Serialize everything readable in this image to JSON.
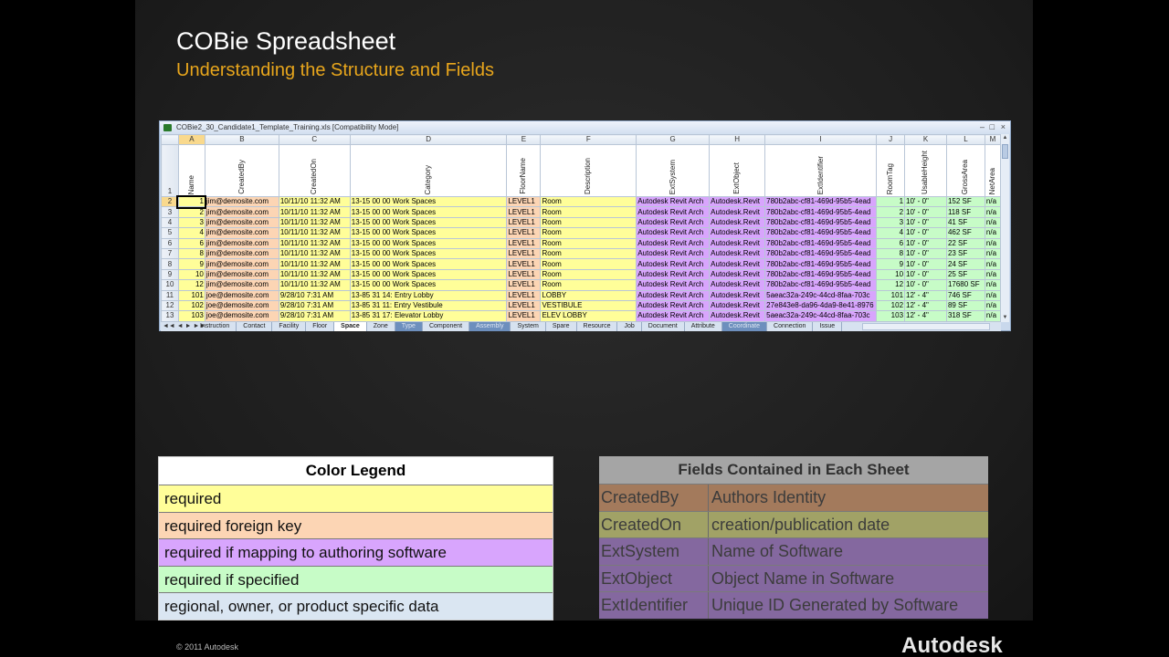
{
  "slide": {
    "title": "COBie Spreadsheet",
    "subtitle": "Understanding the Structure and Fields",
    "copyright": "© 2011 Autodesk",
    "logo": "Autodesk",
    "accent_color": "#e8a61c"
  },
  "workbook": {
    "title": "COBie2_30_Candidate1_Template_Training.xls  [Compatibility Mode]",
    "columns": [
      {
        "letter": "A",
        "field": "Name",
        "fill": "y",
        "selected": true
      },
      {
        "letter": "B",
        "field": "CreatedBy",
        "fill": "o"
      },
      {
        "letter": "C",
        "field": "CreatedOn",
        "fill": "y"
      },
      {
        "letter": "D",
        "field": "Category",
        "fill": "y"
      },
      {
        "letter": "E",
        "field": "FloorName",
        "fill": "o"
      },
      {
        "letter": "F",
        "field": "Description",
        "fill": "y"
      },
      {
        "letter": "G",
        "field": "ExtSystem",
        "fill": "p"
      },
      {
        "letter": "H",
        "field": "ExtObject",
        "fill": "p"
      },
      {
        "letter": "I",
        "field": "ExtIdentifier",
        "fill": "p"
      },
      {
        "letter": "J",
        "field": "RoomTag",
        "fill": "g"
      },
      {
        "letter": "K",
        "field": "UsableHeight",
        "fill": "g"
      },
      {
        "letter": "L",
        "field": "GrossArea",
        "fill": "g"
      },
      {
        "letter": "M",
        "field": "NetArea",
        "fill": "g"
      }
    ],
    "rows": [
      {
        "n": "2",
        "cells": [
          "1",
          "jim@demosite.com",
          "10/11/10 11:32 AM",
          "13-15 00 00 Work Spaces",
          "LEVEL1",
          "Room",
          "Autodesk Revit Arch",
          "Autodesk.Revit",
          "780b2abc-cf81-469d-95b5-4ead",
          "1",
          "10' - 0\"",
          "152 SF",
          "n/a"
        ]
      },
      {
        "n": "3",
        "cells": [
          "2",
          "jim@demosite.com",
          "10/11/10 11:32 AM",
          "13-15 00 00 Work Spaces",
          "LEVEL1",
          "Room",
          "Autodesk Revit Arch",
          "Autodesk.Revit",
          "780b2abc-cf81-469d-95b5-4ead",
          "2",
          "10' - 0\"",
          "118 SF",
          "n/a"
        ]
      },
      {
        "n": "4",
        "cells": [
          "3",
          "jim@demosite.com",
          "10/11/10 11:32 AM",
          "13-15 00 00 Work Spaces",
          "LEVEL1",
          "Room",
          "Autodesk Revit Arch",
          "Autodesk.Revit",
          "780b2abc-cf81-469d-95b5-4ead",
          "3",
          "10' - 0\"",
          "41 SF",
          "n/a"
        ]
      },
      {
        "n": "5",
        "cells": [
          "4",
          "jim@demosite.com",
          "10/11/10 11:32 AM",
          "13-15 00 00 Work Spaces",
          "LEVEL1",
          "Room",
          "Autodesk Revit Arch",
          "Autodesk.Revit",
          "780b2abc-cf81-469d-95b5-4ead",
          "4",
          "10' - 0\"",
          "462 SF",
          "n/a"
        ]
      },
      {
        "n": "6",
        "cells": [
          "6",
          "jim@demosite.com",
          "10/11/10 11:32 AM",
          "13-15 00 00 Work Spaces",
          "LEVEL1",
          "Room",
          "Autodesk Revit Arch",
          "Autodesk.Revit",
          "780b2abc-cf81-469d-95b5-4ead",
          "6",
          "10' - 0\"",
          "22 SF",
          "n/a"
        ]
      },
      {
        "n": "7",
        "cells": [
          "8",
          "jim@demosite.com",
          "10/11/10 11:32 AM",
          "13-15 00 00 Work Spaces",
          "LEVEL1",
          "Room",
          "Autodesk Revit Arch",
          "Autodesk.Revit",
          "780b2abc-cf81-469d-95b5-4ead",
          "8",
          "10' - 0\"",
          "23 SF",
          "n/a"
        ]
      },
      {
        "n": "8",
        "cells": [
          "9",
          "jim@demosite.com",
          "10/11/10 11:32 AM",
          "13-15 00 00 Work Spaces",
          "LEVEL1",
          "Room",
          "Autodesk Revit Arch",
          "Autodesk.Revit",
          "780b2abc-cf81-469d-95b5-4ead",
          "9",
          "10' - 0\"",
          "24 SF",
          "n/a"
        ]
      },
      {
        "n": "9",
        "cells": [
          "10",
          "jim@demosite.com",
          "10/11/10 11:32 AM",
          "13-15 00 00 Work Spaces",
          "LEVEL1",
          "Room",
          "Autodesk Revit Arch",
          "Autodesk.Revit",
          "780b2abc-cf81-469d-95b5-4ead",
          "10",
          "10' - 0\"",
          "25 SF",
          "n/a"
        ]
      },
      {
        "n": "10",
        "cells": [
          "12",
          "jim@demosite.com",
          "10/11/10 11:32 AM",
          "13-15 00 00 Work Spaces",
          "LEVEL1",
          "Room",
          "Autodesk Revit Arch",
          "Autodesk.Revit",
          "780b2abc-cf81-469d-95b5-4ead",
          "12",
          "10' - 0\"",
          "17680 SF",
          "n/a"
        ]
      },
      {
        "n": "11",
        "cells": [
          "101",
          "joe@demosite.com",
          "9/28/10 7:31 AM",
          "13-85 31 14: Entry Lobby",
          "LEVEL1",
          "LOBBY",
          "Autodesk Revit Arch",
          "Autodesk.Revit",
          "5aeac32a-249c-44cd-8faa-703c",
          "101",
          "12' - 4\"",
          "746 SF",
          "n/a"
        ]
      },
      {
        "n": "12",
        "cells": [
          "102",
          "joe@demosite.com",
          "9/28/10 7:31 AM",
          "13-85 31 11: Entry Vestibule",
          "LEVEL1",
          "VESTIBULE",
          "Autodesk Revit Arch",
          "Autodesk.Revit",
          "27e843e8-da96-4da9-8e41-8976",
          "102",
          "12' - 4\"",
          "89 SF",
          "n/a"
        ]
      },
      {
        "n": "13",
        "cells": [
          "103",
          "joe@demosite.com",
          "9/28/10 7:31 AM",
          "13-85 31 17: Elevator Lobby",
          "LEVEL1",
          "ELEV LOBBY",
          "Autodesk Revit Arch",
          "Autodesk.Revit",
          "5aeac32a-249c-44cd-8faa-703c",
          "103",
          "12' - 4\"",
          "318 SF",
          "n/a"
        ]
      }
    ],
    "sheet_tabs": [
      {
        "label": "Instruction"
      },
      {
        "label": "Contact"
      },
      {
        "label": "Facility"
      },
      {
        "label": "Floor"
      },
      {
        "label": "Space",
        "active": true
      },
      {
        "label": "Zone"
      },
      {
        "label": "Type",
        "blue": true
      },
      {
        "label": "Component"
      },
      {
        "label": "Assembly",
        "blue": true
      },
      {
        "label": "System"
      },
      {
        "label": "Spare"
      },
      {
        "label": "Resource"
      },
      {
        "label": "Job"
      },
      {
        "label": "Document"
      },
      {
        "label": "Attribute"
      },
      {
        "label": "Coordinate",
        "blue": true
      },
      {
        "label": "Connection"
      },
      {
        "label": "Issue"
      }
    ]
  },
  "color_legend": {
    "title": "Color Legend",
    "items": [
      {
        "label": "required",
        "color": "#fffe99"
      },
      {
        "label": "required  foreign key",
        "color": "#fcd5b4"
      },
      {
        "label": "required  if mapping to authoring software",
        "color": "#d8a5fd"
      },
      {
        "label": "required  if specified",
        "color": "#c7fcc7"
      },
      {
        "label": "regional,  owner,  or  product specific data",
        "color": "#dae6f2"
      }
    ]
  },
  "fields_legend": {
    "title": "Fields Contained in Each Sheet",
    "items": [
      {
        "field": "CreatedBy",
        "meaning": "Authors Identity",
        "color": "#a37a5c"
      },
      {
        "field": "CreatedOn",
        "meaning": "creation/publication date",
        "color": "#a1a266"
      },
      {
        "field": "ExtSystem",
        "meaning": "Name of Software",
        "color": "#84689f"
      },
      {
        "field": "ExtObject",
        "meaning": "Object Name in Software",
        "color": "#84689f"
      },
      {
        "field": "ExtIdentifier",
        "meaning": "Unique ID Generated by Software",
        "color": "#84689f"
      }
    ]
  }
}
